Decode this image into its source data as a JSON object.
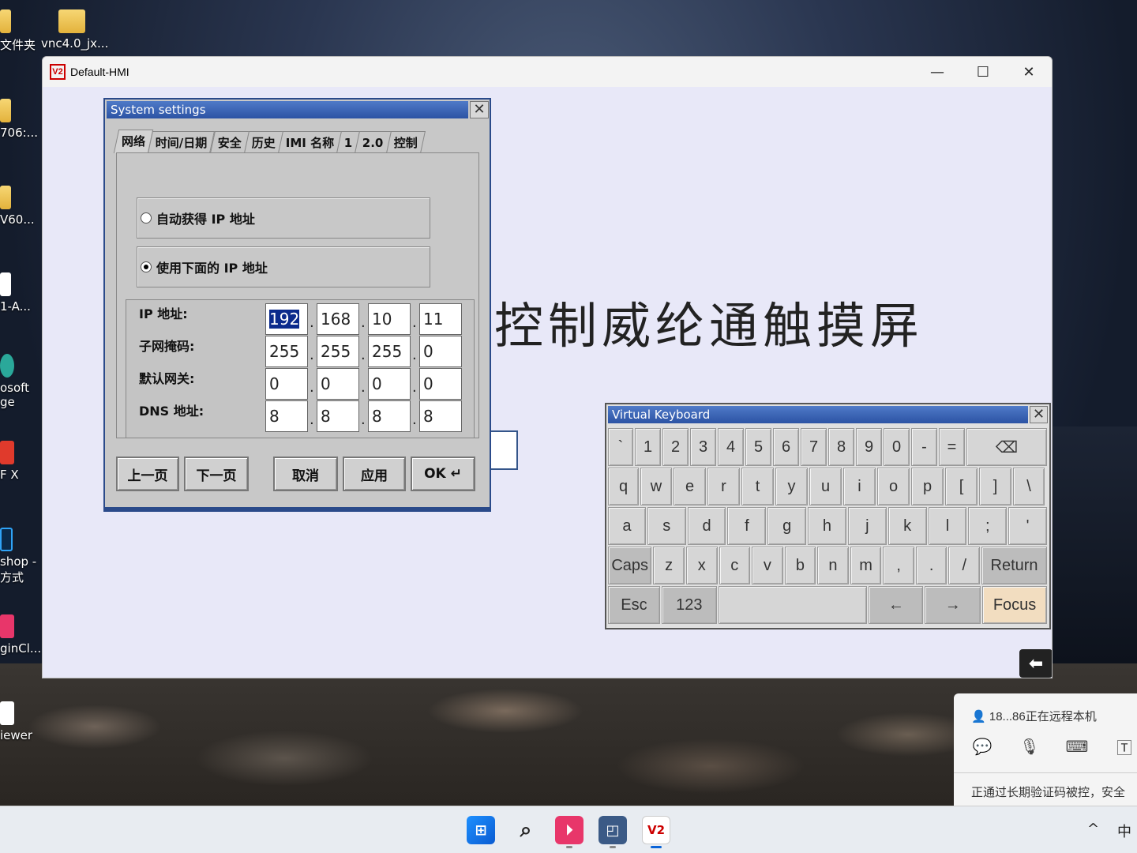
{
  "desktop": {
    "icons": [
      {
        "label": "文件夹"
      },
      {
        "label": "vnc4.0_jx..."
      },
      {
        "label": "706:..."
      },
      {
        "label": "V60..."
      },
      {
        "label": "1-A..."
      },
      {
        "label": "osoft\nge"
      },
      {
        "label": "F X"
      },
      {
        "label": "shop -\n方式"
      },
      {
        "label": "ginCl..."
      },
      {
        "label": "iewer"
      }
    ]
  },
  "window": {
    "title": "Default-HMI",
    "minimize": "—",
    "maximize": "☐",
    "close": "✕"
  },
  "hmi": {
    "headline": "控制威纶通触摸屏",
    "back_symbol": "⬅"
  },
  "dialog": {
    "title": "System settings",
    "close": "✕",
    "tabs": [
      "网络",
      "时间/日期",
      "安全",
      "历史",
      "IMI 名称",
      "1",
      "2.0",
      "控制"
    ],
    "radio_auto": "自动获得 IP 地址",
    "radio_manual": "使用下面的 IP 地址",
    "rows": [
      {
        "label": "IP 地址:",
        "values": [
          "192",
          "168",
          "10",
          "11"
        ]
      },
      {
        "label": "子网掩码:",
        "values": [
          "255",
          "255",
          "255",
          "0"
        ]
      },
      {
        "label": "默认网关:",
        "values": [
          "0",
          "0",
          "0",
          "0"
        ]
      },
      {
        "label": "DNS 地址:",
        "values": [
          "8",
          "8",
          "8",
          "8"
        ]
      }
    ],
    "buttons": {
      "prev": "上一页",
      "next": "下一页",
      "cancel": "取消",
      "apply": "应用",
      "ok": "OK ↵"
    }
  },
  "keyboard": {
    "title": "Virtual Keyboard",
    "close": "✕",
    "row1": [
      "`",
      "1",
      "2",
      "3",
      "4",
      "5",
      "6",
      "7",
      "8",
      "9",
      "0",
      "-",
      "=",
      "⌫"
    ],
    "row2": [
      "q",
      "w",
      "e",
      "r",
      "t",
      "y",
      "u",
      "i",
      "o",
      "p",
      "[",
      "]",
      "\\"
    ],
    "row3": [
      "a",
      "s",
      "d",
      "f",
      "g",
      "h",
      "j",
      "k",
      "l",
      ";",
      "'"
    ],
    "row4": [
      "Caps",
      "z",
      "x",
      "c",
      "v",
      "b",
      "n",
      "m",
      ",",
      ".",
      "/",
      "Return"
    ],
    "row5": [
      "Esc",
      "123",
      "",
      "←",
      "→",
      "Focus"
    ]
  },
  "notification": {
    "user": "18...86正在远程本机",
    "message": "正通过长期验证码被控，安全"
  },
  "taskbar": {
    "tray_chevron": "^",
    "ime": "中"
  },
  "colors": {
    "dialog_title": "#2c53a4",
    "selection": "#0a2a8c",
    "focus_key": "#f2ddc0",
    "hmi_background": "#e8e8f8"
  }
}
